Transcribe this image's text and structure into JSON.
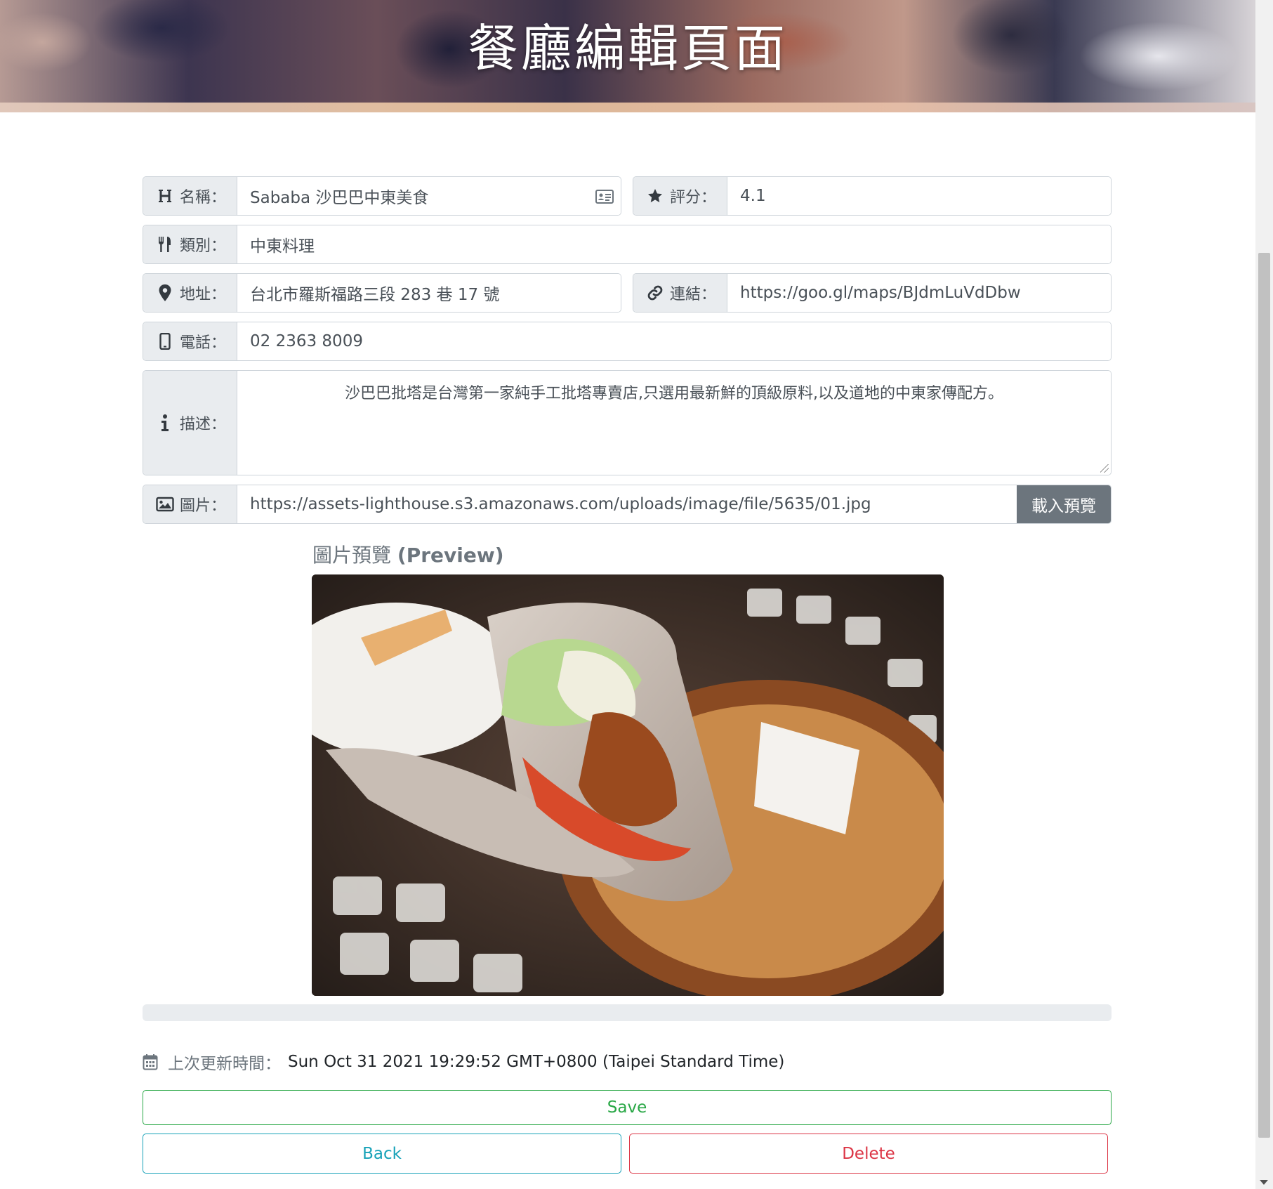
{
  "header": {
    "title": "餐廳編輯頁面"
  },
  "form": {
    "name": {
      "label": "名稱：",
      "value": "Sababa 沙巴巴中東美食",
      "icon": "heading-icon"
    },
    "rating": {
      "label": "評分：",
      "value": "4.1",
      "icon": "star-icon"
    },
    "category": {
      "label": "類別：",
      "value": "中東料理",
      "icon": "utensils-icon"
    },
    "address": {
      "label": "地址：",
      "value": "台北市羅斯福路三段 283 巷 17 號",
      "icon": "map-marker-icon"
    },
    "link": {
      "label": "連結：",
      "value": "https://goo.gl/maps/BJdmLuVdDbw",
      "icon": "link-icon"
    },
    "phone": {
      "label": "電話：",
      "value": "02 2363 8009",
      "icon": "mobile-phone-icon"
    },
    "description": {
      "label": "描述：",
      "value": "沙巴巴批塔是台灣第一家純手工批塔專賣店,只選用最新鮮的頂級原料,以及道地的中東家傳配方。",
      "icon": "info-icon"
    },
    "image": {
      "label": "圖片：",
      "value": "https://assets-lighthouse.s3.amazonaws.com/uploads/image/file/5635/01.jpg",
      "icon": "image-icon",
      "button_label": "載入預覽"
    }
  },
  "preview": {
    "title_cn": "圖片預覽",
    "title_en": "(Preview)"
  },
  "updated": {
    "label": "上次更新時間：",
    "value": "Sun Oct 31 2021 19:29:52 GMT+0800 (Taipei Standard Time)"
  },
  "actions": {
    "save": "Save",
    "back": "Back",
    "delete": "Delete"
  }
}
